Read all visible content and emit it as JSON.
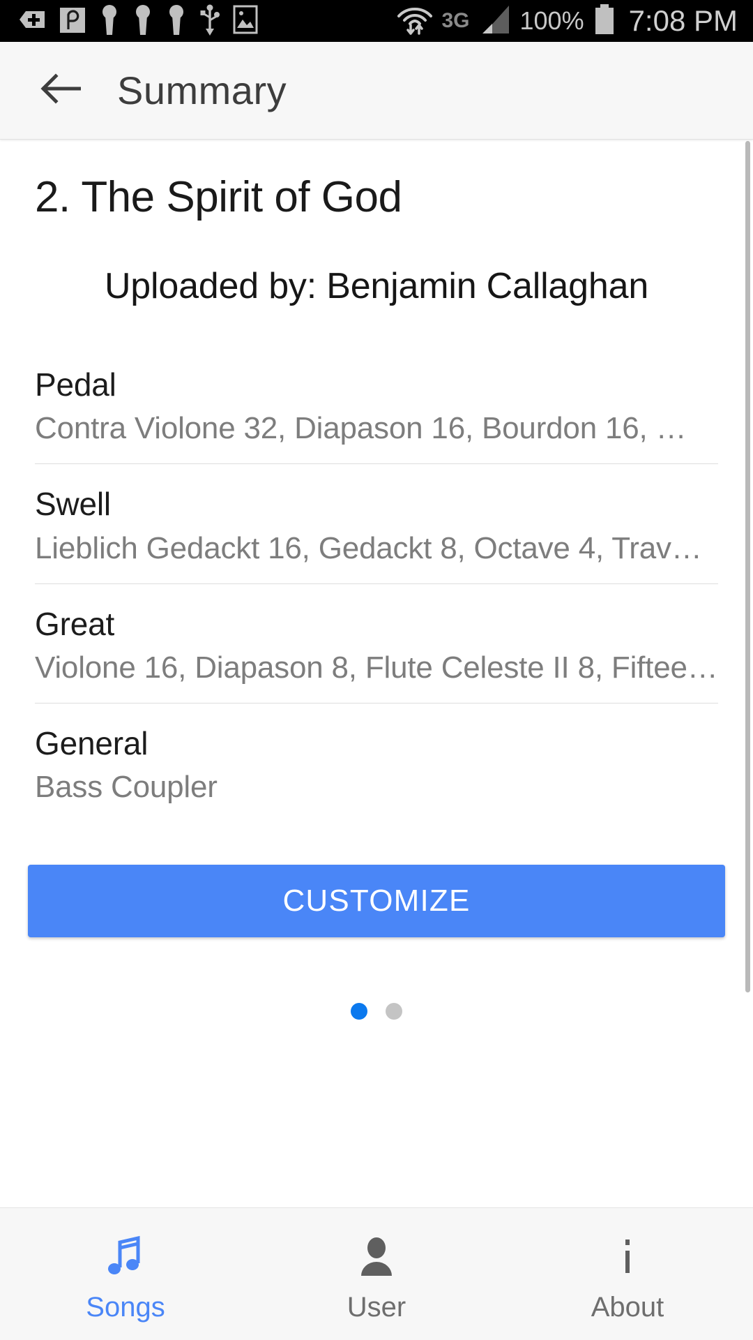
{
  "status_bar": {
    "notification_icons": [
      "tag-plus-icon",
      "p-app-icon",
      "keyhole-icon",
      "keyhole-icon",
      "keyhole-icon",
      "usb-icon",
      "image-icon"
    ],
    "wifi_icon": "wifi-transfer-icon",
    "network_type": "3G",
    "signal_icon": "signal-bars-icon",
    "battery_percent": "100%",
    "battery_icon": "battery-full-icon",
    "clock": "7:08 PM"
  },
  "app_bar": {
    "back_icon": "back-arrow-icon",
    "title": "Summary"
  },
  "content": {
    "song_title": "2. The Spirit of God",
    "uploaded_by": "Uploaded by: Benjamin Callaghan",
    "divisions": [
      {
        "name": "Pedal",
        "stops": "Contra Violone 32, Diapason 16, Bourdon 16, …"
      },
      {
        "name": "Swell",
        "stops": "Lieblich Gedackt 16, Gedackt 8, Octave 4, Trav…"
      },
      {
        "name": "Great",
        "stops": "Violone 16, Diapason 8, Flute Celeste II 8, Fiftee…"
      },
      {
        "name": "General",
        "stops": "Bass Coupler"
      }
    ],
    "customize_label": "CUSTOMIZE",
    "pager": {
      "total": 2,
      "active_index": 0
    }
  },
  "bottom_nav": {
    "items": [
      {
        "label": "Songs",
        "icon": "music-note-icon",
        "active": true
      },
      {
        "label": "User",
        "icon": "person-icon",
        "active": false
      },
      {
        "label": "About",
        "icon": "info-icon",
        "active": false
      }
    ]
  },
  "colors": {
    "accent": "#4a86f7",
    "dot_active": "#0b79ee",
    "app_bar_bg": "#f7f7f7",
    "status_bar_bg": "#000000",
    "secondary_text": "#7d7d7d"
  }
}
